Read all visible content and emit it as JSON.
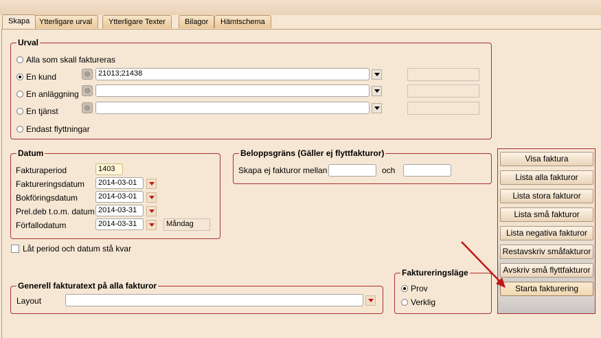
{
  "tabs": [
    "Skapa",
    "Ytterligare urval",
    "Ytterligare Texter",
    "Bilagor",
    "Hämtschema"
  ],
  "urval": {
    "title": "Urval",
    "options": {
      "alla": "Alla som skall faktureras",
      "kund": "En kund",
      "anlaggning": "En anläggning",
      "tjanst": "En tjänst",
      "flytt": "Endast flyttningar"
    },
    "kund_value": "21013;21438",
    "selected": "kund"
  },
  "datum": {
    "title": "Datum",
    "fakturaperiod_label": "Fakturaperiod",
    "fakturaperiod_value": "1403",
    "faktureringsdatum_label": "Faktureringsdatum",
    "faktureringsdatum_value": "2014-03-01",
    "bokforingsdatum_label": "Bokföringsdatum",
    "bokforingsdatum_value": "2014-03-01",
    "prel_label": "Prel.deb t.o.m. datum",
    "prel_value": "2014-03-31",
    "forfallo_label": "Förfallodatum",
    "forfallo_value": "2014-03-31",
    "weekday": "Måndag"
  },
  "belopp": {
    "title": "Beloppsgräns (Gäller ej flyttfakturor)",
    "label": "Skapa ej fakturor mellan",
    "och": "och"
  },
  "lat_period": "Låt period och datum stå kvar",
  "generell": {
    "title": "Generell fakturatext på alla fakturor",
    "layout_label": "Layout"
  },
  "lage": {
    "title": "Faktureringsläge",
    "prov": "Prov",
    "verklig": "Verklig",
    "selected": "prov"
  },
  "buttons": {
    "visa": "Visa faktura",
    "lista_alla": "Lista alla fakturor",
    "lista_stora": "Lista stora fakturor",
    "lista_sma": "Lista små fakturor",
    "lista_negativa": "Lista negativa fakturor",
    "restavskriv": "Restavskriv småfakturor",
    "avskriv_flytt": "Avskriv små flyttfakturor",
    "starta": "Starta fakturering"
  },
  "colors": {
    "group_border": "#a83030",
    "arrow": "#c01818",
    "background": "#f6e7d4"
  }
}
